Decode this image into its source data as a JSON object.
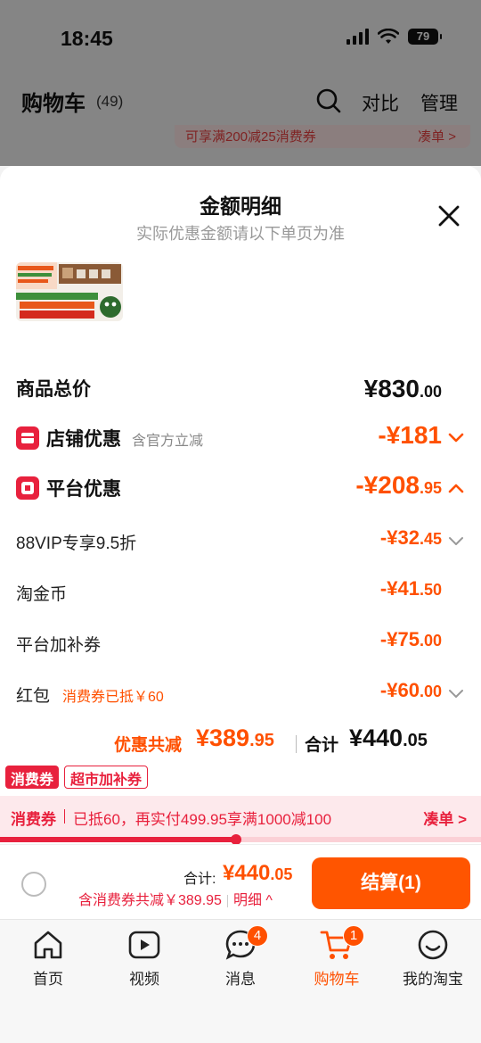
{
  "status_bar": {
    "time": "18:45",
    "battery": "79"
  },
  "cart_header": {
    "title": "购物车",
    "count": "(49)",
    "compare": "对比",
    "manage": "管理"
  },
  "promo_strip": {
    "text": "可享满200减25消费券",
    "link": "凑单 >"
  },
  "sheet": {
    "title": "金额明细",
    "subtitle": "实际优惠金额请以下单页为准",
    "rows": {
      "goods_total": {
        "label": "商品总价",
        "amount_int": "¥830",
        "amount_dec": ".00"
      },
      "shop_discount": {
        "label": "店铺优惠",
        "note": "含官方立减",
        "amount_int": "-¥181",
        "amount_dec": ""
      },
      "platform_discount": {
        "label": "平台优惠",
        "amount_int": "-¥208",
        "amount_dec": ".95"
      },
      "vip": {
        "label": "88VIP专享9.5折",
        "amount_int": "-¥32",
        "amount_dec": ".45"
      },
      "gold_coin": {
        "label": "淘金币",
        "amount_int": "-¥41",
        "amount_dec": ".50"
      },
      "platform_coupon": {
        "label": "平台加补券",
        "amount_int": "-¥75",
        "amount_dec": ".00"
      },
      "red_packet": {
        "label": "红包",
        "note": "消费券已抵￥60",
        "amount_int": "-¥60",
        "amount_dec": ".00"
      }
    },
    "summary": {
      "discount_label": "优惠共减",
      "discount_int": "¥389",
      "discount_dec": ".95",
      "total_label": "合计",
      "total_int": "¥440",
      "total_dec": ".05"
    },
    "tags": [
      "消费券",
      "超市加补券"
    ],
    "coupon_bar": {
      "label": "消费券",
      "text": "已抵60，再实付499.95享满1000减100",
      "link": "凑单 >",
      "progress": 0.49
    }
  },
  "checkout": {
    "total_label": "合计:",
    "total_int": "¥440",
    "total_dec": ".05",
    "detail": "含消费券共减￥389.95",
    "detail_link": "明细 ^",
    "button": "结算(1)"
  },
  "tabbar": {
    "tabs": [
      {
        "label": "首页",
        "icon": "home-icon"
      },
      {
        "label": "视频",
        "icon": "video-icon"
      },
      {
        "label": "消息",
        "icon": "message-icon",
        "badge": "4"
      },
      {
        "label": "购物车",
        "icon": "cart-icon",
        "badge": "1",
        "active": true
      },
      {
        "label": "我的淘宝",
        "icon": "profile-icon"
      }
    ]
  },
  "colors": {
    "accent": "#ff5000",
    "red": "#e8213d"
  }
}
